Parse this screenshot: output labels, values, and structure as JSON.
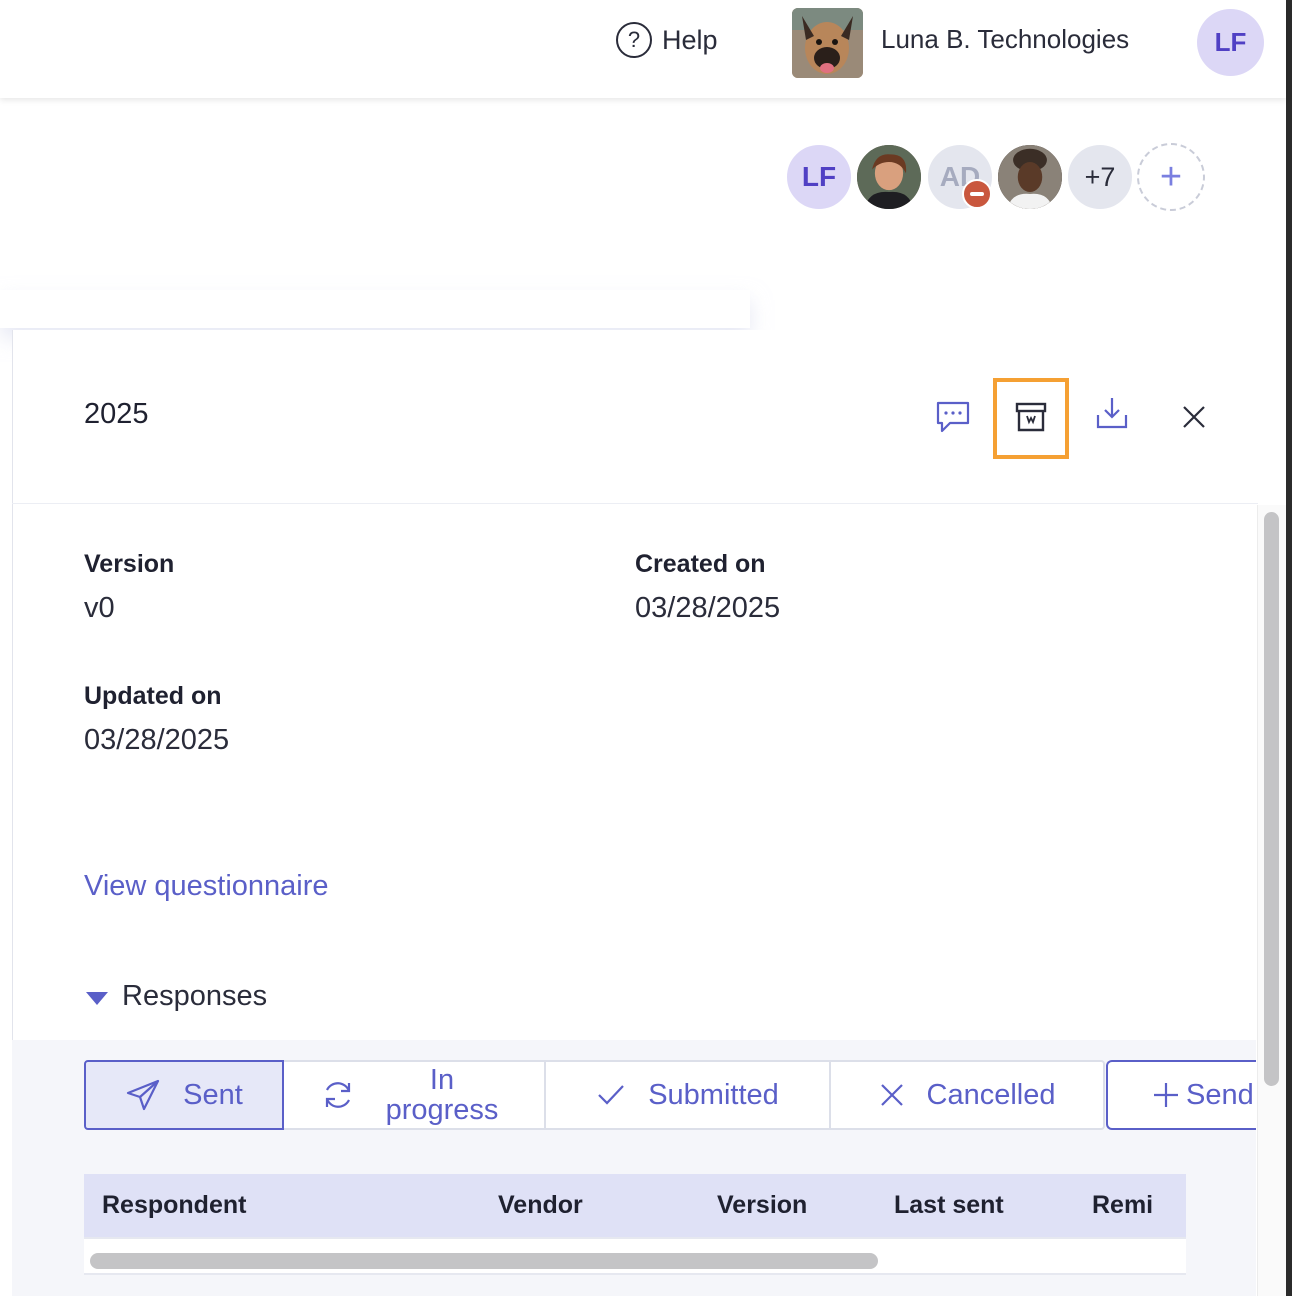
{
  "topbar": {
    "help_label": "Help",
    "org_name": "Luna B. Technologies",
    "user_initials": "LF"
  },
  "collaborators": {
    "items": [
      "LF",
      "",
      "AD",
      ""
    ],
    "more_label": "+7",
    "add_label": "+"
  },
  "panel": {
    "title": "2025",
    "version_label": "Version",
    "version_value": "v0",
    "created_label": "Created on",
    "created_value": "03/28/2025",
    "updated_label": "Updated on",
    "updated_value": "03/28/2025",
    "view_link": "View questionnaire",
    "responses_label": "Responses"
  },
  "tabs": {
    "sent": "Sent",
    "in_progress": "In progress",
    "submitted": "Submitted",
    "cancelled": "Cancelled",
    "send": "Send"
  },
  "table": {
    "columns": [
      "Respondent",
      "Vendor",
      "Version",
      "Last sent",
      "Remi"
    ]
  },
  "colors": {
    "accent": "#5a5fc8",
    "highlight": "#f5a033",
    "avatar_bg": "#dcd7f6"
  }
}
